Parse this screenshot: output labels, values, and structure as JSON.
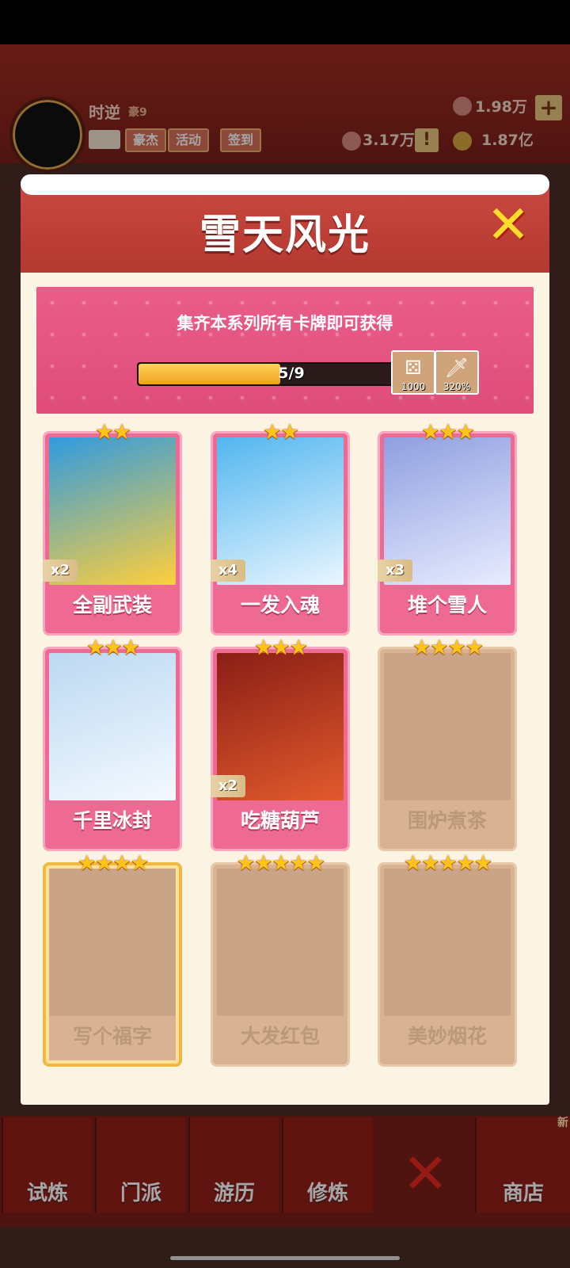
{
  "top": {
    "player_name": "时逆",
    "player_level": "豪9",
    "tags": [
      "豪杰",
      "活动",
      "签到"
    ],
    "resources": {
      "gems": "1.98万",
      "power": "3.17万",
      "coins": "1.87亿"
    }
  },
  "modal": {
    "title": "雪天风光",
    "banner_text": "集齐本系列所有卡牌即可获得",
    "progress": {
      "collected": 5,
      "total": 9,
      "text": "5/9"
    },
    "rewards": [
      {
        "icon": "dice-icon",
        "value": "1000"
      },
      {
        "icon": "sword-icon",
        "value": "320%"
      }
    ],
    "cards": [
      {
        "name": "全副武装",
        "stars": 2,
        "stars_text": "★★",
        "count": "x2",
        "owned": true,
        "colors": [
          "#2f9be0",
          "#ffcf3a"
        ]
      },
      {
        "name": "一发入魂",
        "stars": 2,
        "stars_text": "★★",
        "count": "x4",
        "owned": true,
        "colors": [
          "#52b6ef",
          "#e9f6ff"
        ]
      },
      {
        "name": "堆个雪人",
        "stars": 3,
        "stars_text": "★★★",
        "count": "x3",
        "owned": true,
        "colors": [
          "#8f9fe0",
          "#e8ecff"
        ]
      },
      {
        "name": "千里冰封",
        "stars": 3,
        "stars_text": "★★★",
        "count": "",
        "owned": true,
        "colors": [
          "#bcd9f2",
          "#f4f9ff"
        ]
      },
      {
        "name": "吃糖葫芦",
        "stars": 3,
        "stars_text": "★★★",
        "count": "x2",
        "owned": true,
        "colors": [
          "#8a1e16",
          "#e25a2c"
        ]
      },
      {
        "name": "围炉煮茶",
        "stars": 4,
        "stars_text": "★★★★",
        "count": "",
        "owned": false
      },
      {
        "name": "写个福字",
        "stars": 4,
        "stars_text": "★★★★",
        "count": "",
        "owned": false,
        "gold": true
      },
      {
        "name": "大发红包",
        "stars": 5,
        "stars_text": "★★★★★",
        "count": "",
        "owned": false
      },
      {
        "name": "美妙烟花",
        "stars": 5,
        "stars_text": "★★★★★",
        "count": "",
        "owned": false
      }
    ]
  },
  "bottom_nav": {
    "items": [
      "试炼",
      "门派",
      "游历",
      "修炼",
      "商店"
    ],
    "new_badge": "新"
  }
}
